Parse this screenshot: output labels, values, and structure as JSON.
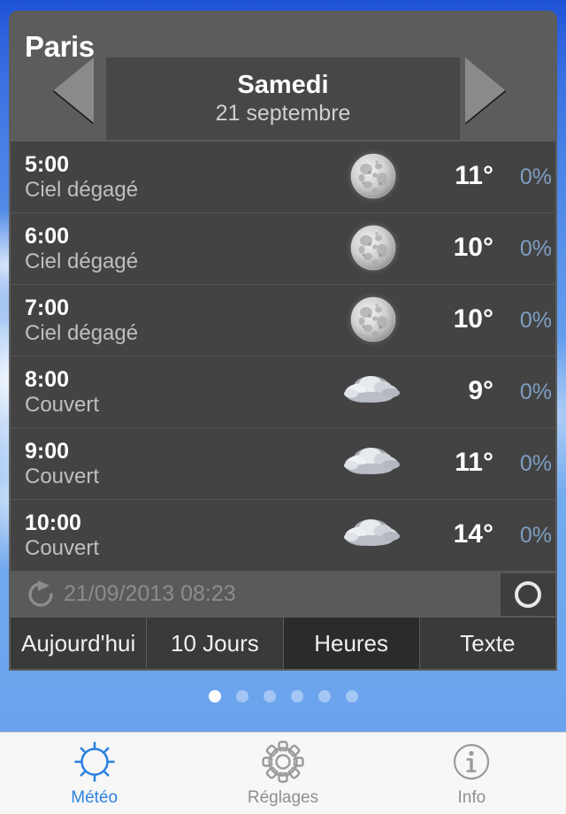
{
  "app": {
    "city": "Paris",
    "prev_day_icon": "triangle-left-icon",
    "next_day_icon": "triangle-right-icon",
    "day_name": "Samedi",
    "date_text": "21 septembre"
  },
  "hours": [
    {
      "time": "5:00",
      "condition": "Ciel dégagé",
      "icon": "moon-icon",
      "temp": "11°",
      "pop": "0%"
    },
    {
      "time": "6:00",
      "condition": "Ciel dégagé",
      "icon": "moon-icon",
      "temp": "10°",
      "pop": "0%"
    },
    {
      "time": "7:00",
      "condition": "Ciel dégagé",
      "icon": "moon-icon",
      "temp": "10°",
      "pop": "0%"
    },
    {
      "time": "8:00",
      "condition": "Couvert",
      "icon": "cloud-icon",
      "temp": "9°",
      "pop": "0%"
    },
    {
      "time": "9:00",
      "condition": "Couvert",
      "icon": "cloud-icon",
      "temp": "11°",
      "pop": "0%"
    },
    {
      "time": "10:00",
      "condition": "Couvert",
      "icon": "cloud-icon",
      "temp": "14°",
      "pop": "0%"
    }
  ],
  "refresh": {
    "icon": "refresh-icon",
    "timestamp": "21/09/2013 08:23",
    "stop_icon": "circle-stop-icon"
  },
  "view_tabs": [
    {
      "label": "Aujourd'hui",
      "active": false
    },
    {
      "label": "10 Jours",
      "active": false
    },
    {
      "label": "Heures",
      "active": true
    },
    {
      "label": "Texte",
      "active": false
    }
  ],
  "pager": {
    "count": 6,
    "active_index": 0
  },
  "tabbar": [
    {
      "label": "Météo",
      "icon": "sun-icon",
      "selected": true
    },
    {
      "label": "Réglages",
      "icon": "gear-icon",
      "selected": false
    },
    {
      "label": "Info",
      "icon": "info-icon",
      "selected": false
    }
  ],
  "colors": {
    "accent_blue": "#2b82e0",
    "pop_blue": "#7e9ec2",
    "panel_gray": "#5c5c5c",
    "row_gray": "#434343"
  }
}
